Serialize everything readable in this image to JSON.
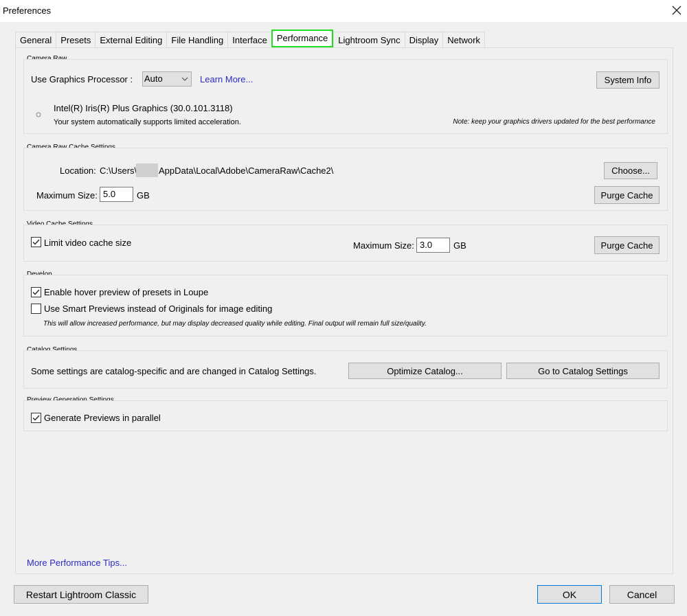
{
  "window": {
    "title": "Preferences"
  },
  "tabs": [
    {
      "label": "General"
    },
    {
      "label": "Presets"
    },
    {
      "label": "External Editing"
    },
    {
      "label": "File Handling"
    },
    {
      "label": "Interface"
    },
    {
      "label": "Performance"
    },
    {
      "label": "Lightroom Sync"
    },
    {
      "label": "Display"
    },
    {
      "label": "Network"
    }
  ],
  "active_tab": "Performance",
  "camera_raw": {
    "heading": "Camera Raw",
    "gpu_label": "Use Graphics Processor :",
    "gpu_value": "Auto",
    "learn_more": "Learn More...",
    "system_info": "System Info",
    "gpu_name": "Intel(R) Iris(R) Plus Graphics (30.0.101.3118)",
    "gpu_status": "Your system automatically supports limited acceleration.",
    "note": "Note: keep your graphics drivers updated for the best performance"
  },
  "cache": {
    "heading": "Camera Raw Cache Settings",
    "location_label": "Location:",
    "location_prefix": "C:\\Users\\",
    "location_suffix": "AppData\\Local\\Adobe\\CameraRaw\\Cache2\\",
    "choose": "Choose...",
    "max_label": "Maximum Size:",
    "max_value": "5.0",
    "unit": "GB",
    "purge": "Purge Cache"
  },
  "video": {
    "heading": "Video Cache Settings",
    "limit_label": "Limit video cache size",
    "limit_checked": true,
    "max_label": "Maximum Size:",
    "max_value": "3.0",
    "unit": "GB",
    "purge": "Purge Cache"
  },
  "develop": {
    "heading": "Develop",
    "hover_label": "Enable hover preview of presets in Loupe",
    "hover_checked": true,
    "smart_label": "Use Smart Previews instead of Originals for image editing",
    "smart_checked": false,
    "smart_note": "This will allow increased performance, but may display decreased quality while editing. Final output will remain full size/quality."
  },
  "catalog": {
    "heading": "Catalog Settings",
    "text": "Some settings are catalog-specific and are changed in Catalog Settings.",
    "optimize": "Optimize Catalog...",
    "goto": "Go to Catalog Settings"
  },
  "preview": {
    "heading": "Preview Generation Settings",
    "parallel_label": "Generate Previews in parallel",
    "parallel_checked": true
  },
  "footer": {
    "tips_link": "More Performance Tips...",
    "restart": "Restart Lightroom Classic",
    "ok": "OK",
    "cancel": "Cancel"
  },
  "colors": {
    "active_tab_border": "#22dd22",
    "link": "#2b2bc8",
    "primary_button_border": "#0078d7"
  }
}
